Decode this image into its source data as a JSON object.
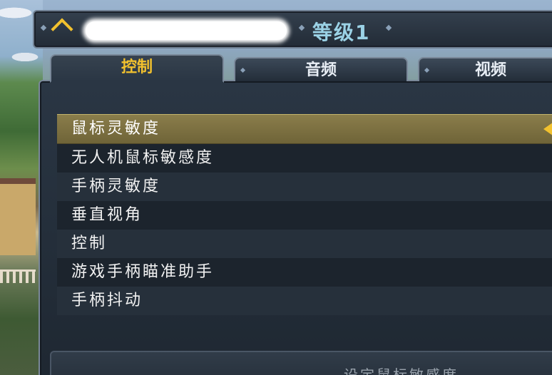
{
  "header": {
    "level_label": "等级1",
    "username_redacted": ""
  },
  "tabs": [
    {
      "label": "控制",
      "active": true
    },
    {
      "label": "音频",
      "active": false
    },
    {
      "label": "视频",
      "active": false
    }
  ],
  "settings": [
    {
      "label": "鼠标灵敏度",
      "selected": true
    },
    {
      "label": "无人机鼠标敏感度",
      "selected": false
    },
    {
      "label": "手柄灵敏度",
      "selected": false
    },
    {
      "label": "垂直视角",
      "selected": false
    },
    {
      "label": "控制",
      "selected": false
    },
    {
      "label": "游戏手柄瞄准助手",
      "selected": false
    },
    {
      "label": "手柄抖动",
      "selected": false
    }
  ],
  "description": "设定鼠标敏感度",
  "colors": {
    "accent": "#f2c12e",
    "level_text": "#9bd2e6",
    "selected_row": "#8a7d4b"
  }
}
